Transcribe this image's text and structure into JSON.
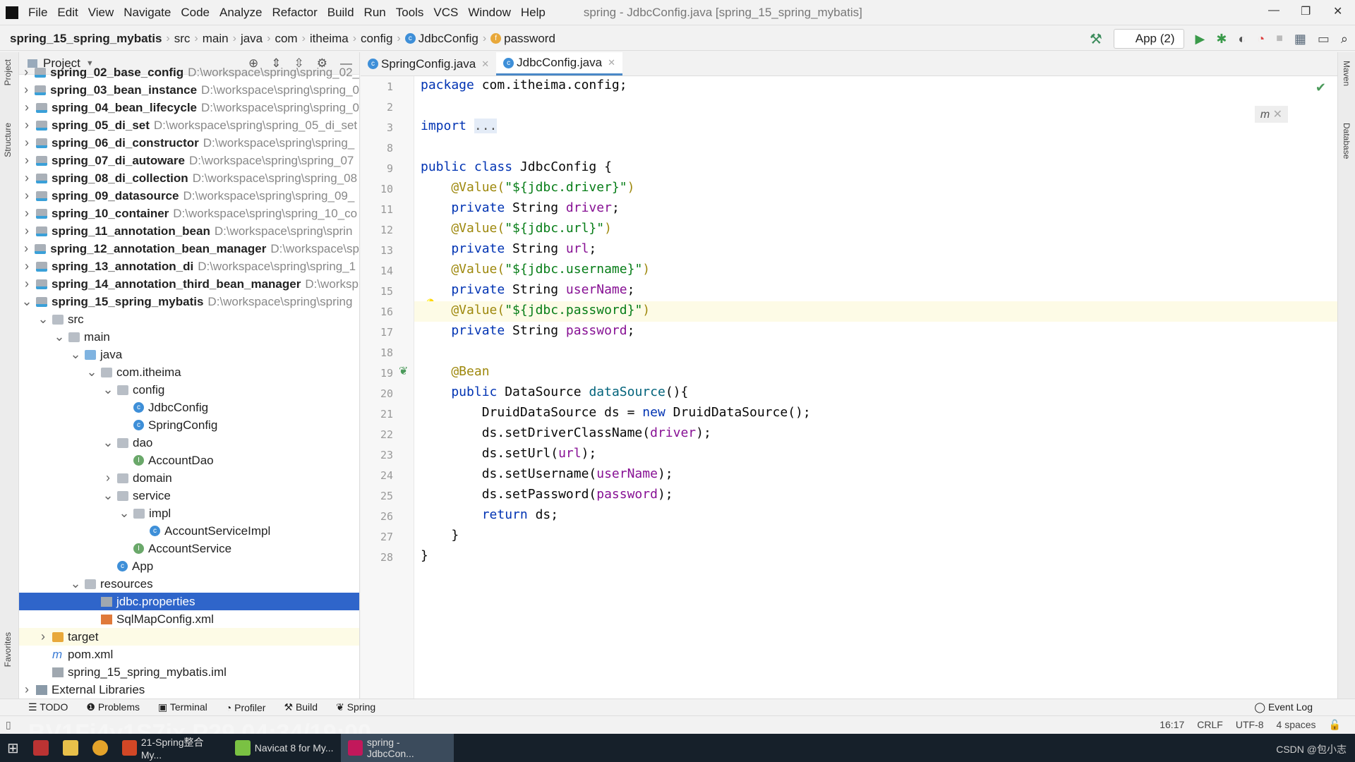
{
  "app": {
    "title": "spring - JdbcConfig.java [spring_15_spring_mybatis]",
    "logo": "IJ"
  },
  "menu": [
    "File",
    "Edit",
    "View",
    "Navigate",
    "Code",
    "Analyze",
    "Refactor",
    "Build",
    "Run",
    "Tools",
    "VCS",
    "Window",
    "Help"
  ],
  "breadcrumb": [
    "spring_15_spring_mybatis",
    "src",
    "main",
    "java",
    "com",
    "itheima",
    "config",
    "JdbcConfig",
    "password"
  ],
  "toolbar": {
    "run_config": "App (2)"
  },
  "left_strip": [
    "Project",
    "Structure",
    "Favorites"
  ],
  "right_strip": [
    "Maven",
    "Database"
  ],
  "project": {
    "title": "Project",
    "modules": [
      {
        "name": "spring_02_base_config",
        "path": "D:\\workspace\\spring\\spring_02_"
      },
      {
        "name": "spring_03_bean_instance",
        "path": "D:\\workspace\\spring\\spring_0"
      },
      {
        "name": "spring_04_bean_lifecycle",
        "path": "D:\\workspace\\spring\\spring_0"
      },
      {
        "name": "spring_05_di_set",
        "path": "D:\\workspace\\spring\\spring_05_di_set"
      },
      {
        "name": "spring_06_di_constructor",
        "path": "D:\\workspace\\spring\\spring_"
      },
      {
        "name": "spring_07_di_autoware",
        "path": "D:\\workspace\\spring\\spring_07"
      },
      {
        "name": "spring_08_di_collection",
        "path": "D:\\workspace\\spring\\spring_08"
      },
      {
        "name": "spring_09_datasource",
        "path": "D:\\workspace\\spring\\spring_09_"
      },
      {
        "name": "spring_10_container",
        "path": "D:\\workspace\\spring\\spring_10_co"
      },
      {
        "name": "spring_11_annotation_bean",
        "path": "D:\\workspace\\spring\\sprin"
      },
      {
        "name": "spring_12_annotation_bean_manager",
        "path": "D:\\workspace\\sp"
      },
      {
        "name": "spring_13_annotation_di",
        "path": "D:\\workspace\\spring\\spring_1"
      },
      {
        "name": "spring_14_annotation_third_bean_manager",
        "path": "D:\\worksp"
      },
      {
        "name": "spring_15_spring_mybatis",
        "path": "D:\\workspace\\spring\\spring"
      }
    ],
    "tree": [
      {
        "label": "src",
        "depth": 1,
        "icon": "folder",
        "arrow": "v"
      },
      {
        "label": "main",
        "depth": 2,
        "icon": "folder",
        "arrow": "v"
      },
      {
        "label": "java",
        "depth": 3,
        "icon": "bfolder",
        "arrow": "v"
      },
      {
        "label": "com.itheima",
        "depth": 4,
        "icon": "folder",
        "arrow": "v"
      },
      {
        "label": "config",
        "depth": 5,
        "icon": "folder",
        "arrow": "v"
      },
      {
        "label": "JdbcConfig",
        "depth": 6,
        "icon": "class",
        "arrow": ""
      },
      {
        "label": "SpringConfig",
        "depth": 6,
        "icon": "class",
        "arrow": ""
      },
      {
        "label": "dao",
        "depth": 5,
        "icon": "folder",
        "arrow": "v"
      },
      {
        "label": "AccountDao",
        "depth": 6,
        "icon": "interface",
        "arrow": ""
      },
      {
        "label": "domain",
        "depth": 5,
        "icon": "folder",
        "arrow": ">"
      },
      {
        "label": "service",
        "depth": 5,
        "icon": "folder",
        "arrow": "v"
      },
      {
        "label": "impl",
        "depth": 6,
        "icon": "folder",
        "arrow": "v"
      },
      {
        "label": "AccountServiceImpl",
        "depth": 7,
        "icon": "class",
        "arrow": ""
      },
      {
        "label": "AccountService",
        "depth": 6,
        "icon": "interface",
        "arrow": ""
      },
      {
        "label": "App",
        "depth": 5,
        "icon": "class",
        "arrow": ""
      },
      {
        "label": "resources",
        "depth": 3,
        "icon": "folder",
        "arrow": "v"
      },
      {
        "label": "jdbc.properties",
        "depth": 4,
        "icon": "file",
        "arrow": "",
        "selected": true
      },
      {
        "label": "SqlMapConfig.xml",
        "depth": 4,
        "icon": "xml",
        "arrow": ""
      },
      {
        "label": "target",
        "depth": 1,
        "icon": "yfolder",
        "arrow": ">",
        "target": true
      },
      {
        "label": "pom.xml",
        "depth": 1,
        "icon": "maven",
        "arrow": ""
      },
      {
        "label": "spring_15_spring_mybatis.iml",
        "depth": 1,
        "icon": "file",
        "arrow": ""
      },
      {
        "label": "External Libraries",
        "depth": 0,
        "icon": "lib",
        "arrow": ">"
      }
    ]
  },
  "tabs": [
    {
      "label": "SpringConfig.java",
      "active": false
    },
    {
      "label": "JdbcConfig.java",
      "active": true
    }
  ],
  "code": [
    {
      "n": "1",
      "t": [
        [
          "package ",
          "kw"
        ],
        [
          "com.itheima.config;",
          ""
        ]
      ]
    },
    {
      "n": "2",
      "t": []
    },
    {
      "n": "3",
      "t": [
        [
          "import ",
          "kw"
        ],
        [
          "...",
          "fold"
        ]
      ]
    },
    {
      "n": "8",
      "t": []
    },
    {
      "n": "9",
      "t": [
        [
          "public class ",
          "kw"
        ],
        [
          "JdbcConfig {",
          ""
        ]
      ]
    },
    {
      "n": "10",
      "t": [
        [
          "    @Value(",
          "ann"
        ],
        [
          "\"${jdbc.driver}\"",
          "str"
        ],
        [
          ")",
          "ann"
        ]
      ]
    },
    {
      "n": "11",
      "t": [
        [
          "    private ",
          "kw"
        ],
        [
          "String ",
          ""
        ],
        [
          "driver",
          "fld"
        ],
        [
          ";",
          ""
        ]
      ]
    },
    {
      "n": "12",
      "t": [
        [
          "    @Value(",
          "ann"
        ],
        [
          "\"${jdbc.url}\"",
          "str"
        ],
        [
          ")",
          "ann"
        ]
      ]
    },
    {
      "n": "13",
      "t": [
        [
          "    private ",
          "kw"
        ],
        [
          "String ",
          ""
        ],
        [
          "url",
          "fld"
        ],
        [
          ";",
          ""
        ]
      ]
    },
    {
      "n": "14",
      "t": [
        [
          "    @Value(",
          "ann"
        ],
        [
          "\"${jdbc.username}\"",
          "str"
        ],
        [
          ")",
          "ann"
        ]
      ]
    },
    {
      "n": "15",
      "t": [
        [
          "    private ",
          "kw"
        ],
        [
          "String ",
          ""
        ],
        [
          "userName",
          "fld"
        ],
        [
          ";",
          ""
        ]
      ]
    },
    {
      "n": "16",
      "t": [
        [
          "    @Value(",
          "ann"
        ],
        [
          "\"${jdbc.password}\"",
          "str"
        ],
        [
          ")",
          "ann"
        ]
      ],
      "current": true
    },
    {
      "n": "17",
      "t": [
        [
          "    private ",
          "kw"
        ],
        [
          "String ",
          ""
        ],
        [
          "password",
          "fld"
        ],
        [
          ";",
          ""
        ]
      ]
    },
    {
      "n": "18",
      "t": []
    },
    {
      "n": "19",
      "t": [
        [
          "    @Bean",
          "ann"
        ]
      ]
    },
    {
      "n": "20",
      "t": [
        [
          "    public ",
          "kw"
        ],
        [
          "DataSource ",
          ""
        ],
        [
          "dataSource",
          "mth"
        ],
        [
          "(){",
          ""
        ]
      ]
    },
    {
      "n": "21",
      "t": [
        [
          "        DruidDataSource ds = ",
          ""
        ],
        [
          "new ",
          "kw"
        ],
        [
          "DruidDataSource();",
          ""
        ]
      ]
    },
    {
      "n": "22",
      "t": [
        [
          "        ds.setDriverClassName(",
          ""
        ],
        [
          "driver",
          "fld"
        ],
        [
          ");",
          ""
        ]
      ]
    },
    {
      "n": "23",
      "t": [
        [
          "        ds.setUrl(",
          ""
        ],
        [
          "url",
          "fld"
        ],
        [
          ");",
          ""
        ]
      ]
    },
    {
      "n": "24",
      "t": [
        [
          "        ds.setUsername(",
          ""
        ],
        [
          "userName",
          "fld"
        ],
        [
          ");",
          ""
        ]
      ]
    },
    {
      "n": "25",
      "t": [
        [
          "        ds.setPassword(",
          ""
        ],
        [
          "password",
          "fld"
        ],
        [
          ");",
          ""
        ]
      ]
    },
    {
      "n": "26",
      "t": [
        [
          "        return ",
          "kw"
        ],
        [
          "ds;",
          ""
        ]
      ]
    },
    {
      "n": "27",
      "t": [
        [
          "    }",
          ""
        ]
      ]
    },
    {
      "n": "28",
      "t": [
        [
          "}",
          ""
        ]
      ]
    }
  ],
  "bottom_tools": [
    "TODO",
    "Problems",
    "Terminal",
    "Profiler",
    "Build",
    "Spring"
  ],
  "event_log": "Event Log",
  "status": {
    "position": "16:17",
    "line_sep": "CRLF",
    "encoding": "UTF-8",
    "indent": "4 spaces"
  },
  "taskbar": [
    {
      "label": "21-Spring整合My...",
      "color": "#d24726"
    },
    {
      "label": "Navicat 8 for My...",
      "color": "#7ac143"
    },
    {
      "label": "spring - JdbcCon...",
      "color": "#c2185b",
      "active": true
    }
  ],
  "watermark": "CSDN @包小志",
  "video_overlay": "BV1Fi4y1S7ix P29 04:34/19:00"
}
